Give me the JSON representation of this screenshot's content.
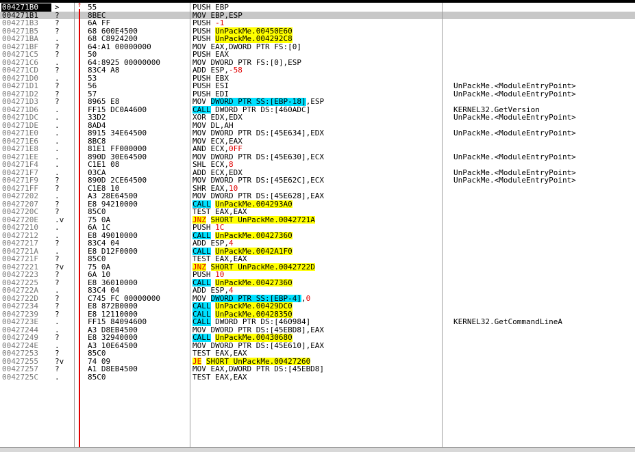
{
  "disassembly": {
    "rows": [
      {
        "addr": "004271B0",
        "flag": ">",
        "hex": "55",
        "dis": [
          {
            "t": "PUSH EBP"
          }
        ],
        "cmt": ""
      },
      {
        "addr": "004271B1",
        "flag": "?",
        "hex": "8BEC",
        "dis": [
          {
            "t": "MOV EBP,ESP"
          }
        ],
        "cmt": ""
      },
      {
        "addr": "004271B3",
        "flag": "?",
        "hex": "6A FF",
        "dis": [
          {
            "t": "PUSH "
          },
          {
            "t": "-1",
            "c": "r"
          }
        ],
        "cmt": ""
      },
      {
        "addr": "004271B5",
        "flag": "?",
        "hex": "68 600E4500",
        "dis": [
          {
            "t": "PUSH "
          },
          {
            "t": "UnPackMe.00450E60",
            "c": "y"
          }
        ],
        "cmt": ""
      },
      {
        "addr": "004271BA",
        "flag": ".",
        "hex": "68 C8924200",
        "dis": [
          {
            "t": "PUSH "
          },
          {
            "t": "UnPackMe.004292C8",
            "c": "y"
          }
        ],
        "cmt": ""
      },
      {
        "addr": "004271BF",
        "flag": "?",
        "hex": "64:A1 00000000",
        "dis": [
          {
            "t": "MOV EAX,DWORD PTR FS:[0]"
          }
        ],
        "cmt": ""
      },
      {
        "addr": "004271C5",
        "flag": "?",
        "hex": "50",
        "dis": [
          {
            "t": "PUSH EAX"
          }
        ],
        "cmt": ""
      },
      {
        "addr": "004271C6",
        "flag": ".",
        "hex": "64:8925 00000000",
        "dis": [
          {
            "t": "MOV DWORD PTR FS:[0],ESP"
          }
        ],
        "cmt": ""
      },
      {
        "addr": "004271CD",
        "flag": "?",
        "hex": "83C4 A8",
        "dis": [
          {
            "t": "ADD ESP,"
          },
          {
            "t": "-58",
            "c": "r"
          }
        ],
        "cmt": ""
      },
      {
        "addr": "004271D0",
        "flag": ".",
        "hex": "53",
        "dis": [
          {
            "t": "PUSH EBX"
          }
        ],
        "cmt": ""
      },
      {
        "addr": "004271D1",
        "flag": "?",
        "hex": "56",
        "dis": [
          {
            "t": "PUSH ESI"
          }
        ],
        "cmt": "UnPackMe.<ModuleEntryPoint>"
      },
      {
        "addr": "004271D2",
        "flag": "?",
        "hex": "57",
        "dis": [
          {
            "t": "PUSH EDI"
          }
        ],
        "cmt": "UnPackMe.<ModuleEntryPoint>"
      },
      {
        "addr": "004271D3",
        "flag": "?",
        "hex": "8965 E8",
        "dis": [
          {
            "t": "MOV "
          },
          {
            "t": "DWORD PTR SS:[EBP-18]",
            "c": "c"
          },
          {
            "t": ",ESP"
          }
        ],
        "cmt": ""
      },
      {
        "addr": "004271D6",
        "flag": ".",
        "hex": "FF15 DC0A4600",
        "dis": [
          {
            "t": "CALL",
            "c": "c"
          },
          {
            "t": " DWORD PTR DS:[460ADC]"
          }
        ],
        "cmt": "KERNEL32.GetVersion"
      },
      {
        "addr": "004271DC",
        "flag": ".",
        "hex": "33D2",
        "dis": [
          {
            "t": "XOR EDX,EDX"
          }
        ],
        "cmt": "UnPackMe.<ModuleEntryPoint>"
      },
      {
        "addr": "004271DE",
        "flag": ".",
        "hex": "8AD4",
        "dis": [
          {
            "t": "MOV DL,AH"
          }
        ],
        "cmt": ""
      },
      {
        "addr": "004271E0",
        "flag": ".",
        "hex": "8915 34E64500",
        "dis": [
          {
            "t": "MOV DWORD PTR DS:[45E634],EDX"
          }
        ],
        "cmt": "UnPackMe.<ModuleEntryPoint>"
      },
      {
        "addr": "004271E6",
        "flag": ".",
        "hex": "8BC8",
        "dis": [
          {
            "t": "MOV ECX,EAX"
          }
        ],
        "cmt": ""
      },
      {
        "addr": "004271E8",
        "flag": ".",
        "hex": "81E1 FF000000",
        "dis": [
          {
            "t": "AND ECX,"
          },
          {
            "t": "0FF",
            "c": "r"
          }
        ],
        "cmt": ""
      },
      {
        "addr": "004271EE",
        "flag": ".",
        "hex": "890D 30E64500",
        "dis": [
          {
            "t": "MOV DWORD PTR DS:[45E630],ECX"
          }
        ],
        "cmt": "UnPackMe.<ModuleEntryPoint>"
      },
      {
        "addr": "004271F4",
        "flag": ".",
        "hex": "C1E1 08",
        "dis": [
          {
            "t": "SHL ECX,"
          },
          {
            "t": "8",
            "c": "r"
          }
        ],
        "cmt": ""
      },
      {
        "addr": "004271F7",
        "flag": ".",
        "hex": "03CA",
        "dis": [
          {
            "t": "ADD ECX,EDX"
          }
        ],
        "cmt": "UnPackMe.<ModuleEntryPoint>"
      },
      {
        "addr": "004271F9",
        "flag": "?",
        "hex": "890D 2CE64500",
        "dis": [
          {
            "t": "MOV DWORD PTR DS:[45E62C],ECX"
          }
        ],
        "cmt": "UnPackMe.<ModuleEntryPoint>"
      },
      {
        "addr": "004271FF",
        "flag": "?",
        "hex": "C1E8 10",
        "dis": [
          {
            "t": "SHR EAX,"
          },
          {
            "t": "10",
            "c": "r"
          }
        ],
        "cmt": ""
      },
      {
        "addr": "00427202",
        "flag": ".",
        "hex": "A3 28E64500",
        "dis": [
          {
            "t": "MOV DWORD PTR DS:[45E628],EAX"
          }
        ],
        "cmt": ""
      },
      {
        "addr": "00427207",
        "flag": "?",
        "hex": "E8 94210000",
        "dis": [
          {
            "t": "CALL",
            "c": "c"
          },
          {
            "t": " "
          },
          {
            "t": "UnPackMe.004293A0",
            "c": "y"
          }
        ],
        "cmt": ""
      },
      {
        "addr": "0042720C",
        "flag": "?",
        "hex": "85C0",
        "dis": [
          {
            "t": "TEST EAX,EAX"
          }
        ],
        "cmt": ""
      },
      {
        "addr": "0042720E",
        "flag": ".v",
        "hex": "75 0A",
        "dis": [
          {
            "t": "JNZ",
            "c": "yr"
          },
          {
            "t": " "
          },
          {
            "t": "SHORT UnPackMe.0042721A",
            "c": "y"
          }
        ],
        "cmt": ""
      },
      {
        "addr": "00427210",
        "flag": ".",
        "hex": "6A 1C",
        "dis": [
          {
            "t": "PUSH "
          },
          {
            "t": "1C",
            "c": "r"
          }
        ],
        "cmt": ""
      },
      {
        "addr": "00427212",
        "flag": ".",
        "hex": "E8 49010000",
        "dis": [
          {
            "t": "CALL",
            "c": "c"
          },
          {
            "t": " "
          },
          {
            "t": "UnPackMe.00427360",
            "c": "y"
          }
        ],
        "cmt": ""
      },
      {
        "addr": "00427217",
        "flag": "?",
        "hex": "83C4 04",
        "dis": [
          {
            "t": "ADD ESP,"
          },
          {
            "t": "4",
            "c": "r"
          }
        ],
        "cmt": ""
      },
      {
        "addr": "0042721A",
        "flag": ".",
        "hex": "E8 D12F0000",
        "dis": [
          {
            "t": "CALL",
            "c": "c"
          },
          {
            "t": " "
          },
          {
            "t": "UnPackMe.0042A1F0",
            "c": "y"
          }
        ],
        "cmt": ""
      },
      {
        "addr": "0042721F",
        "flag": "?",
        "hex": "85C0",
        "dis": [
          {
            "t": "TEST EAX,EAX"
          }
        ],
        "cmt": ""
      },
      {
        "addr": "00427221",
        "flag": "?v",
        "hex": "75 0A",
        "dis": [
          {
            "t": "JNZ",
            "c": "yr"
          },
          {
            "t": " "
          },
          {
            "t": "SHORT UnPackMe.0042722D",
            "c": "y"
          }
        ],
        "cmt": ""
      },
      {
        "addr": "00427223",
        "flag": "?",
        "hex": "6A 10",
        "dis": [
          {
            "t": "PUSH "
          },
          {
            "t": "10",
            "c": "r"
          }
        ],
        "cmt": ""
      },
      {
        "addr": "00427225",
        "flag": "?",
        "hex": "E8 36010000",
        "dis": [
          {
            "t": "CALL",
            "c": "c"
          },
          {
            "t": " "
          },
          {
            "t": "UnPackMe.00427360",
            "c": "y"
          }
        ],
        "cmt": ""
      },
      {
        "addr": "0042722A",
        "flag": ".",
        "hex": "83C4 04",
        "dis": [
          {
            "t": "ADD ESP,"
          },
          {
            "t": "4",
            "c": "r"
          }
        ],
        "cmt": ""
      },
      {
        "addr": "0042722D",
        "flag": "?",
        "hex": "C745 FC 00000000",
        "dis": [
          {
            "t": "MOV "
          },
          {
            "t": "DWORD PTR SS:[EBP-4]",
            "c": "c"
          },
          {
            "t": ","
          },
          {
            "t": "0",
            "c": "r"
          }
        ],
        "cmt": ""
      },
      {
        "addr": "00427234",
        "flag": "?",
        "hex": "E8 872B0000",
        "dis": [
          {
            "t": "CALL",
            "c": "c"
          },
          {
            "t": " "
          },
          {
            "t": "UnPackMe.00429DC0",
            "c": "y"
          }
        ],
        "cmt": ""
      },
      {
        "addr": "00427239",
        "flag": "?",
        "hex": "E8 12110000",
        "dis": [
          {
            "t": "CALL",
            "c": "c"
          },
          {
            "t": " "
          },
          {
            "t": "UnPackMe.00428350",
            "c": "y"
          }
        ],
        "cmt": ""
      },
      {
        "addr": "0042723E",
        "flag": ".",
        "hex": "FF15 84094600",
        "dis": [
          {
            "t": "CALL",
            "c": "c"
          },
          {
            "t": " DWORD PTR DS:[460984]"
          }
        ],
        "cmt": "KERNEL32.GetCommandLineA"
      },
      {
        "addr": "00427244",
        "flag": ".",
        "hex": "A3 D8EB4500",
        "dis": [
          {
            "t": "MOV DWORD PTR DS:[45EBD8],EAX"
          }
        ],
        "cmt": ""
      },
      {
        "addr": "00427249",
        "flag": "?",
        "hex": "E8 32940000",
        "dis": [
          {
            "t": "CALL",
            "c": "c"
          },
          {
            "t": " "
          },
          {
            "t": "UnPackMe.00430680",
            "c": "y"
          }
        ],
        "cmt": ""
      },
      {
        "addr": "0042724E",
        "flag": ".",
        "hex": "A3 10E64500",
        "dis": [
          {
            "t": "MOV DWORD PTR DS:[45E610],EAX"
          }
        ],
        "cmt": ""
      },
      {
        "addr": "00427253",
        "flag": "?",
        "hex": "85C0",
        "dis": [
          {
            "t": "TEST EAX,EAX"
          }
        ],
        "cmt": ""
      },
      {
        "addr": "00427255",
        "flag": "?v",
        "hex": "74 09",
        "dis": [
          {
            "t": "JE",
            "c": "yr"
          },
          {
            "t": " "
          },
          {
            "t": "SHORT UnPackMe.00427260",
            "c": "y"
          }
        ],
        "cmt": ""
      },
      {
        "addr": "00427257",
        "flag": "?",
        "hex": "A1 D8EB4500",
        "dis": [
          {
            "t": "MOV EAX,DWORD PTR DS:[45EBD8]"
          }
        ],
        "cmt": ""
      },
      {
        "addr": "0042725C",
        "flag": ".",
        "hex": "85C0",
        "dis": [
          {
            "t": "TEST EAX,EAX"
          }
        ],
        "cmt": ""
      }
    ],
    "colors": {
      "highlight_yellow": "#ffff00",
      "highlight_cyan": "#00e0ff",
      "immediate_red": "#e00000",
      "selection": "#c8c8c8"
    }
  }
}
